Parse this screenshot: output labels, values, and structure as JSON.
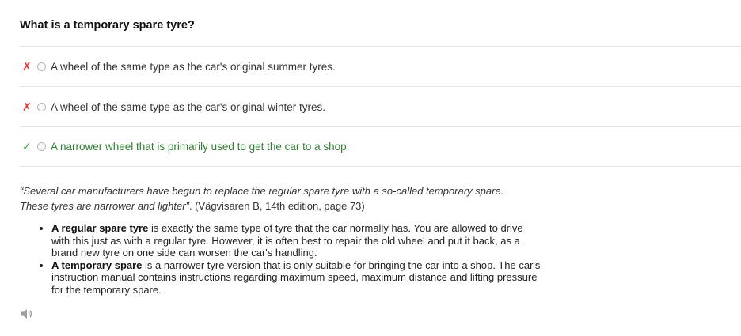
{
  "question": {
    "title": "What is a temporary spare tyre?"
  },
  "options": [
    {
      "mark": "✗",
      "status": "wrong",
      "text": "A wheel of the same type as the car's original summer tyres."
    },
    {
      "mark": "✗",
      "status": "wrong",
      "text": "A wheel of the same type as the car's original winter tyres."
    },
    {
      "mark": "✓",
      "status": "correct",
      "text": "A narrower wheel that is primarily used to get the car to a shop."
    }
  ],
  "explanation": {
    "quote_italic": "“Several car manufacturers have begun to replace the regular spare tyre with a so-called temporary spare. These tyres are narrower and lighter”",
    "quote_source": ". (Vägvisaren B, 14th edition, page 73)",
    "bullets": [
      {
        "term": "A regular spare tyre",
        "text": " is exactly the same type of tyre that the car normally has. You are allowed to drive with this just as with a regular tyre. However, it is often best to repair the old wheel and put it back, as a brand new tyre on one side can worsen the car's handling."
      },
      {
        "term": "A temporary spare",
        "text": " is a narrower tyre version that is only suitable for bringing the car into a shop. The car's instruction manual contains instructions regarding maximum speed, maximum distance and lifting pressure for the temporary spare."
      }
    ]
  },
  "colors": {
    "wrong": "#e53935",
    "correct": "#43a047",
    "correct_text": "#2e7d32",
    "divider": "#e4e4e4",
    "speaker": "#9e9e9e"
  },
  "icons": {
    "wrong_mark": "cross-icon",
    "correct_mark": "check-icon",
    "audio": "speaker-icon"
  }
}
